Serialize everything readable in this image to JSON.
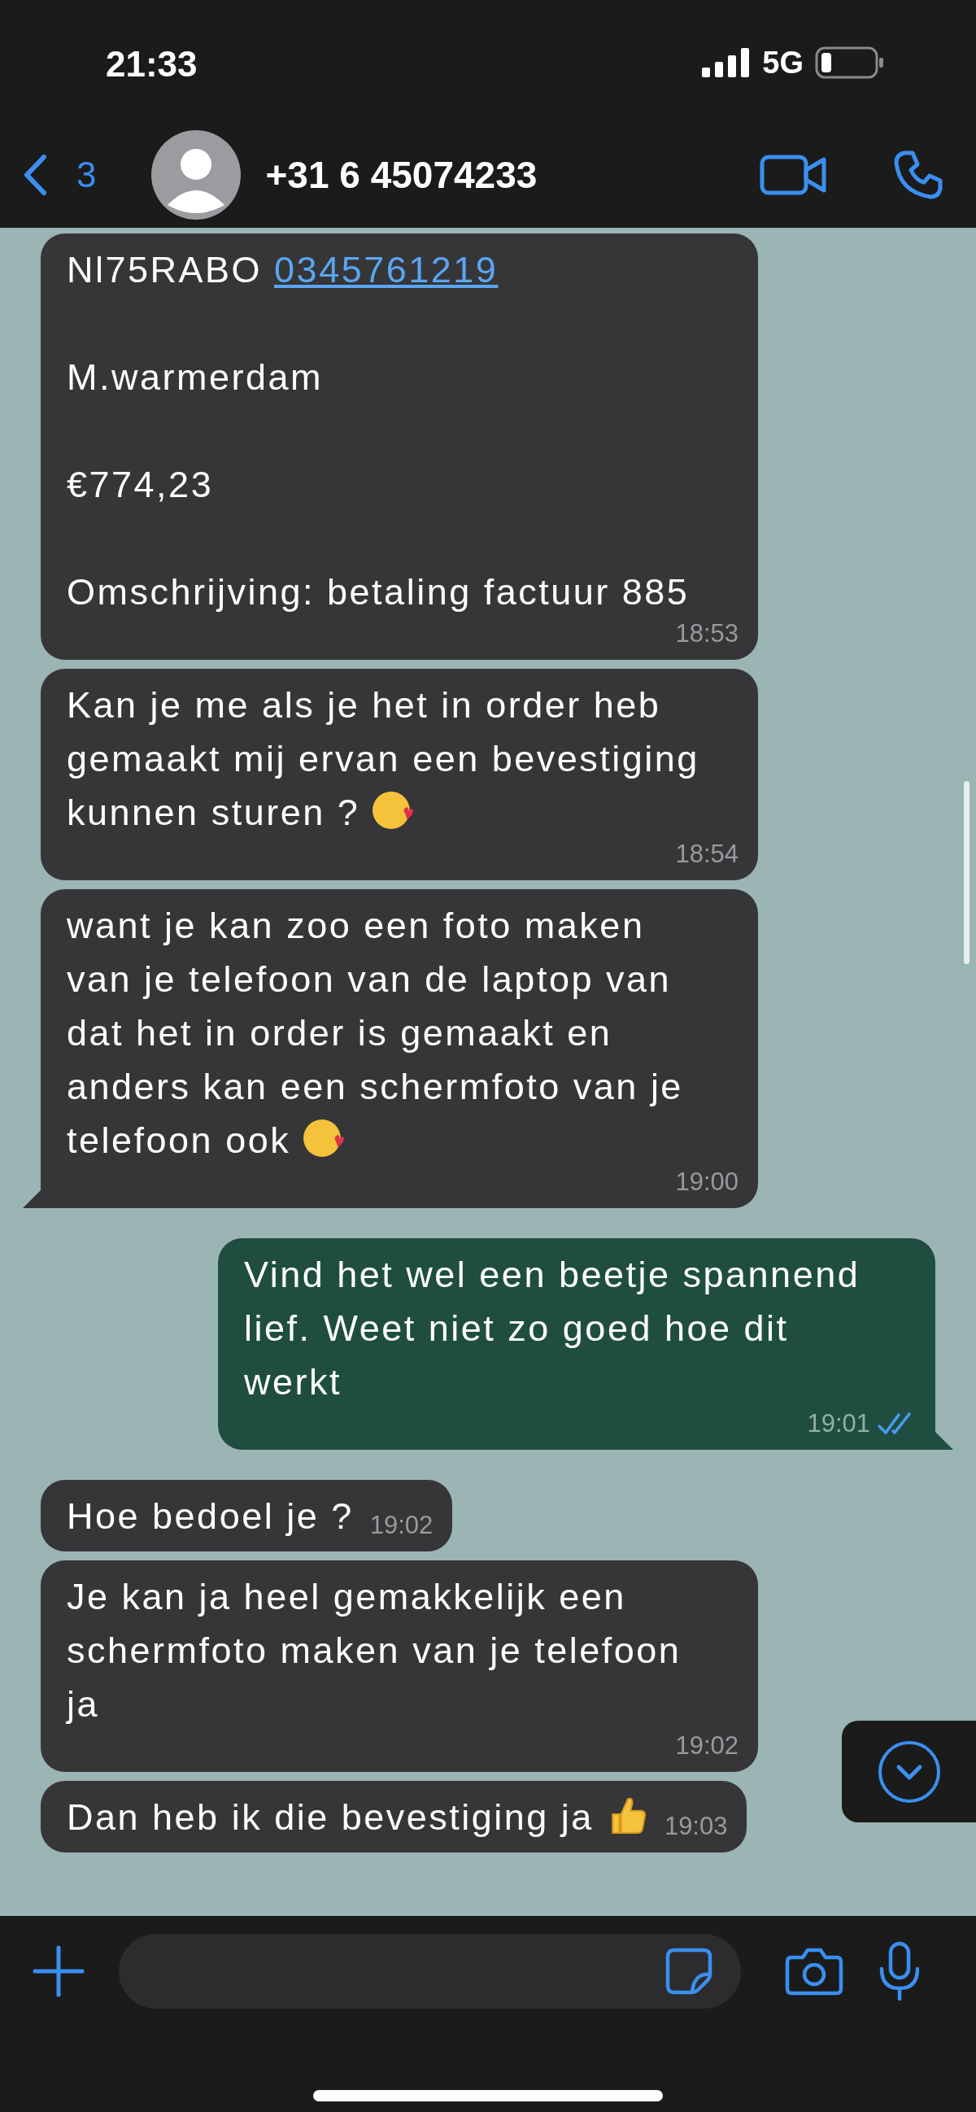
{
  "status_bar": {
    "time": "21:33",
    "network": "5G"
  },
  "header": {
    "back_count": "3",
    "contact": "+31 6 45074233"
  },
  "messages": [
    {
      "kind": "incoming",
      "tail": false,
      "time": "18:53",
      "segments": [
        {
          "kind": "text",
          "text": "Nl75RABO "
        },
        {
          "kind": "link",
          "text": "0345761219"
        },
        {
          "kind": "text",
          "text": "\n\nM.warmerdam\n\n€774,23\n\nOmschrijving: betaling factuur 885"
        }
      ]
    },
    {
      "kind": "incoming",
      "tail": false,
      "time": "18:54",
      "segments": [
        {
          "kind": "text",
          "text": "Kan je me als je het in order heb\ngemaakt mij ervan een bevestiging\nkunnen sturen ? "
        },
        {
          "kind": "kiss-emoji"
        }
      ]
    },
    {
      "kind": "incoming",
      "tail": true,
      "time": "19:00",
      "segments": [
        {
          "kind": "text",
          "text": "want je kan zoo een foto maken\nvan je telefoon van de laptop van\ndat het in order is gemaakt en\nanders kan een schermfoto van je\ntelefoon ook "
        },
        {
          "kind": "kiss-emoji"
        }
      ]
    },
    {
      "kind": "outgoing",
      "tail": true,
      "time": "19:01",
      "read": true,
      "segments": [
        {
          "kind": "text",
          "text": "Vind het wel een beetje spannend\nlief. Weet niet zo goed hoe dit\nwerkt"
        }
      ]
    },
    {
      "kind": "incoming",
      "tail": false,
      "time": "19:02",
      "segments": [
        {
          "kind": "text",
          "text": "Hoe bedoel je ?"
        }
      ]
    },
    {
      "kind": "incoming",
      "tail": false,
      "time": "19:02",
      "segments": [
        {
          "kind": "text",
          "text": "Je kan ja heel gemakkelijk een\nschermfoto maken van je telefoon\nja"
        }
      ]
    },
    {
      "kind": "incoming",
      "tail": false,
      "time": "19:03",
      "segments": [
        {
          "kind": "text",
          "text": "Dan heb ik die bevestiging ja "
        },
        {
          "kind": "thumbs-up-emoji"
        }
      ]
    }
  ]
}
